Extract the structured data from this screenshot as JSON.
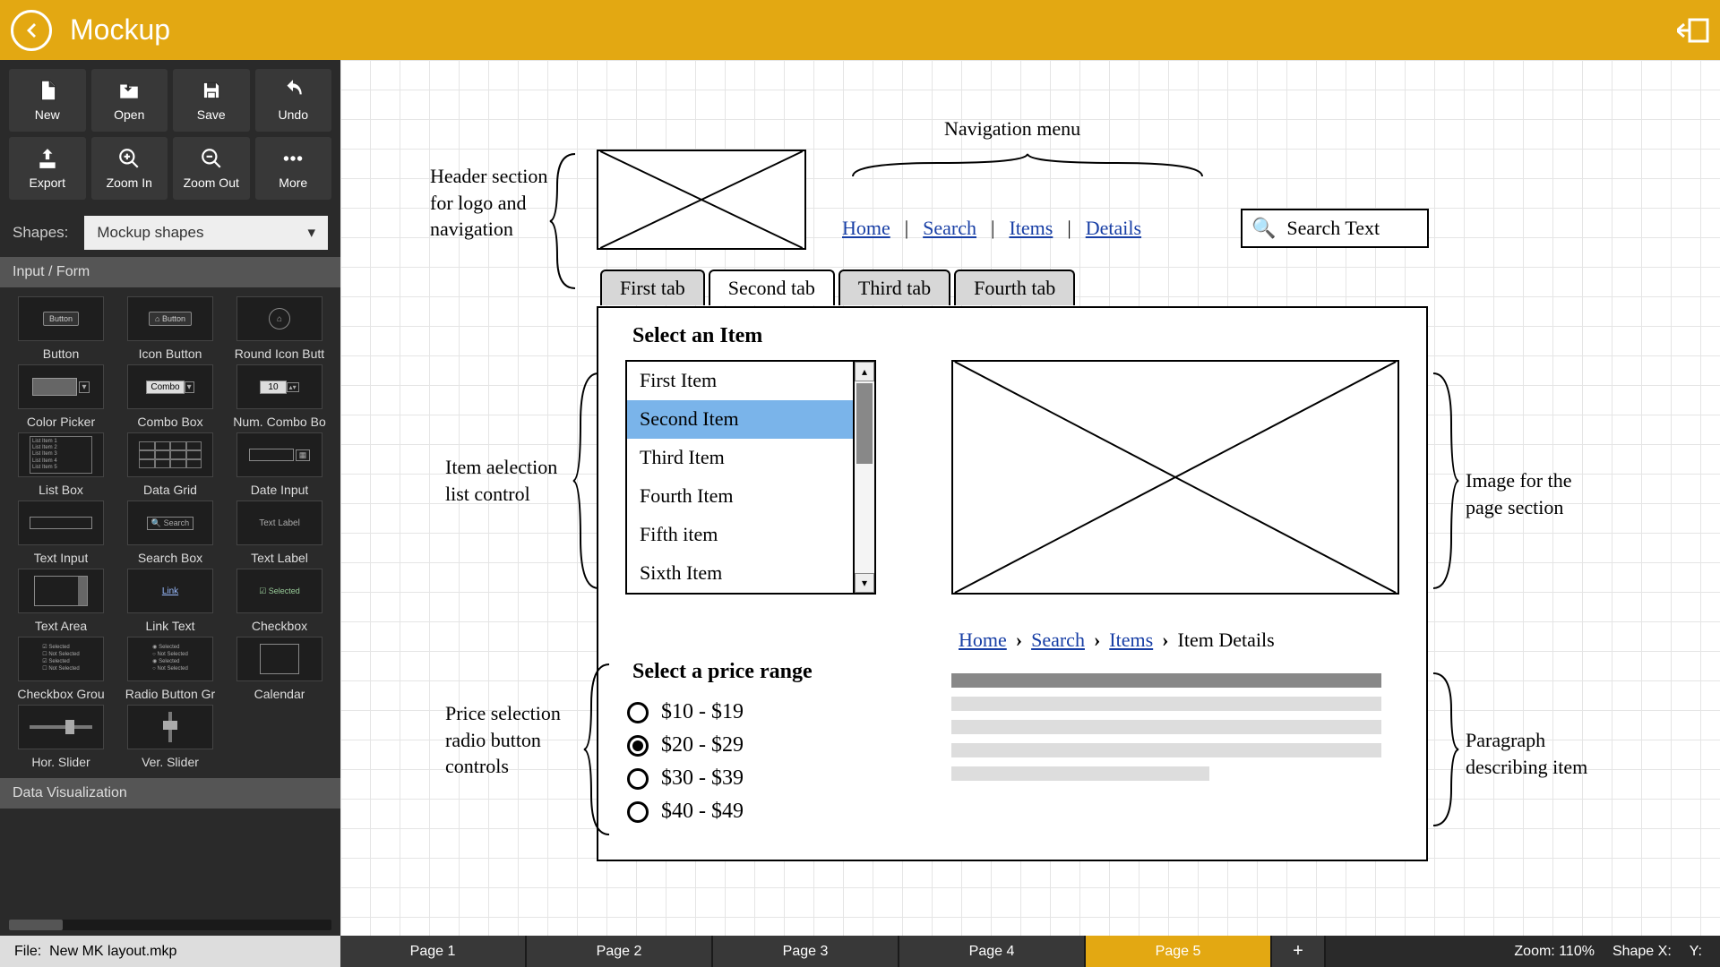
{
  "app": {
    "title": "Mockup"
  },
  "toolbar": [
    {
      "id": "new",
      "label": "New"
    },
    {
      "id": "open",
      "label": "Open"
    },
    {
      "id": "save",
      "label": "Save"
    },
    {
      "id": "undo",
      "label": "Undo"
    },
    {
      "id": "export",
      "label": "Export"
    },
    {
      "id": "zoomin",
      "label": "Zoom In"
    },
    {
      "id": "zoomout",
      "label": "Zoom Out"
    },
    {
      "id": "more",
      "label": "More"
    }
  ],
  "shapes": {
    "label": "Shapes:",
    "selected": "Mockup shapes"
  },
  "categories": {
    "input_form": "Input / Form",
    "data_viz": "Data Visualization"
  },
  "shape_items": [
    "Button",
    "Icon Button",
    "Round Icon Butt",
    "Color Picker",
    "Combo Box",
    "Num. Combo Bo",
    "List Box",
    "Data Grid",
    "Date Input",
    "Text Input",
    "Search Box",
    "Text Label",
    "Text Area",
    "Link Text",
    "Checkbox",
    "Checkbox Grou",
    "Radio Button Gr",
    "Calendar",
    "Hor. Slider",
    "Ver. Slider"
  ],
  "shape_thumb_text": {
    "btn": "Button",
    "iconbtn": "Button",
    "combo": "Combo",
    "num": "10",
    "search": "Search",
    "link": "Link",
    "textlabel": "Text Label",
    "checkbox": "Selected"
  },
  "mockup": {
    "annotations": {
      "header": "Header section for logo and navigation",
      "navmenu": "Navigation menu",
      "itemlist": "Item aelection list control",
      "priceradio": "Price selection radio button controls",
      "image": "Image for the page section",
      "para": "Paragraph describing item"
    },
    "nav_links": [
      "Home",
      "Search",
      "Items",
      "Details"
    ],
    "search_placeholder": "Search Text",
    "tabs": [
      "First tab",
      "Second tab",
      "Third tab",
      "Fourth tab"
    ],
    "active_tab": 1,
    "section_select_item": "Select an Item",
    "list_items": [
      "First Item",
      "Second Item",
      "Third Item",
      "Fourth Item",
      "Fifth item",
      "Sixth Item"
    ],
    "list_selected": 1,
    "section_price": "Select a price range",
    "price_options": [
      "$10 - $19",
      "$20 - $29",
      "$30 - $39",
      "$40 - $49"
    ],
    "price_selected": 1,
    "breadcrumb": [
      "Home",
      "Search",
      "Items",
      "Item Details"
    ]
  },
  "footer": {
    "file_label": "File:",
    "file_name": "New MK layout.mkp",
    "pages": [
      "Page 1",
      "Page 2",
      "Page 3",
      "Page 4",
      "Page 5"
    ],
    "active_page": 4,
    "zoom_label": "Zoom:",
    "zoom_value": "110%",
    "shapex": "Shape X:",
    "y": "Y:"
  }
}
